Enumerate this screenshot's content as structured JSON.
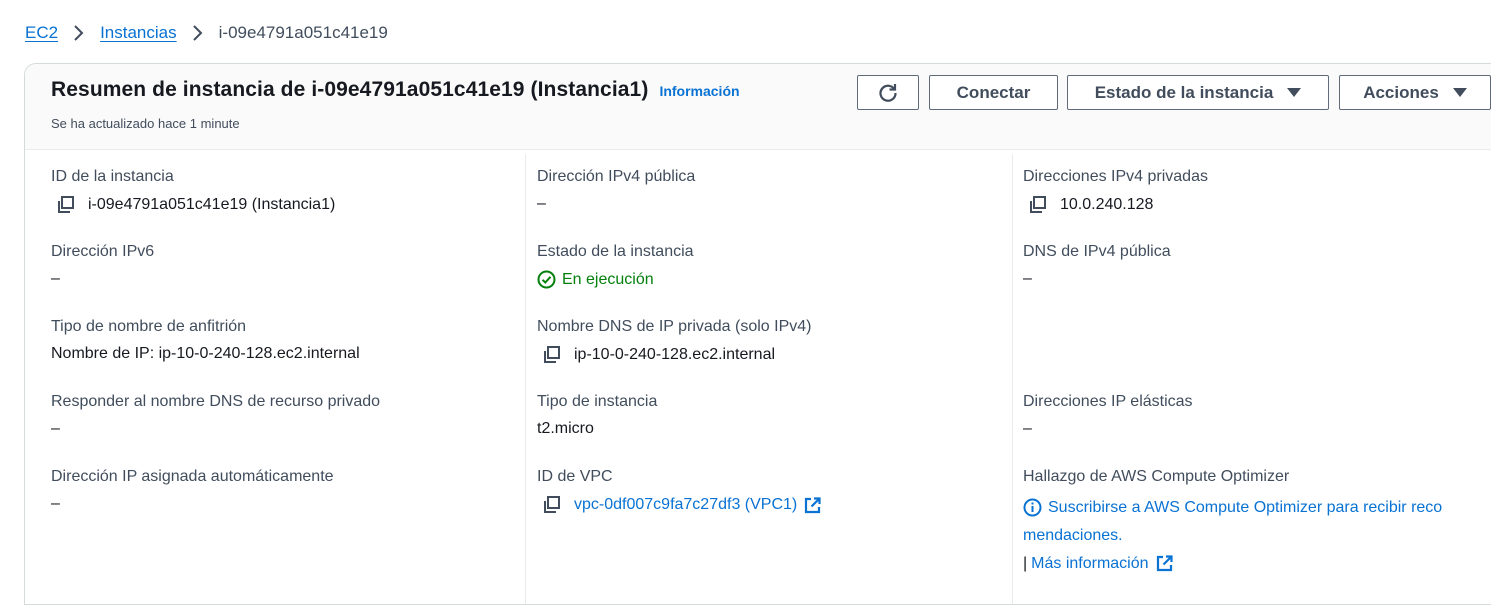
{
  "breadcrumb": {
    "root": "EC2",
    "section": "Instancias",
    "current": "i-09e4791a051c41e19"
  },
  "header": {
    "title": "Resumen de instancia de i-09e4791a051c41e19 (Instancia1)",
    "info_link": "Información",
    "updated": "Se ha actualizado hace 1 minute",
    "buttons": {
      "connect": "Conectar",
      "instance_state": "Estado de la instancia",
      "actions": "Acciones"
    }
  },
  "details": {
    "instance_id": {
      "label": "ID de la instancia",
      "value": "i-09e4791a051c41e19 (Instancia1)"
    },
    "ipv6": {
      "label": "Dirección IPv6",
      "value": "–"
    },
    "hostname_type": {
      "label": "Tipo de nombre de anfitrión",
      "value": "Nombre de IP: ip-10-0-240-128.ec2.internal"
    },
    "private_dns_answer": {
      "label": "Responder al nombre DNS de recurso privado",
      "value": "–"
    },
    "auto_ip": {
      "label": "Dirección IP asignada automáticamente",
      "value": "–"
    },
    "public_ipv4": {
      "label": "Dirección IPv4 pública",
      "value": "–"
    },
    "instance_state": {
      "label": "Estado de la instancia",
      "value": "En ejecución"
    },
    "private_dns": {
      "label": "Nombre DNS de IP privada (solo IPv4)",
      "value": "ip-10-0-240-128.ec2.internal"
    },
    "instance_type": {
      "label": "Tipo de instancia",
      "value": "t2.micro"
    },
    "vpc": {
      "label": "ID de VPC",
      "value": "vpc-0df007c9fa7c27df3 (VPC1)"
    },
    "private_ipv4": {
      "label": "Direcciones IPv4 privadas",
      "value": "10.0.240.128"
    },
    "public_dns": {
      "label": "DNS de IPv4 pública",
      "value": "–"
    },
    "elastic_ip": {
      "label": "Direcciones IP elásticas",
      "value": "–"
    },
    "optimizer": {
      "label": "Hallazgo de AWS Compute Optimizer",
      "value": "Suscribirse a AWS Compute Optimizer para recibir reco mendaciones.",
      "more": "Más información"
    }
  },
  "colors": {
    "link": "#0972d3",
    "success": "#037f0c",
    "text": "#16191f",
    "label": "#414d5c"
  }
}
